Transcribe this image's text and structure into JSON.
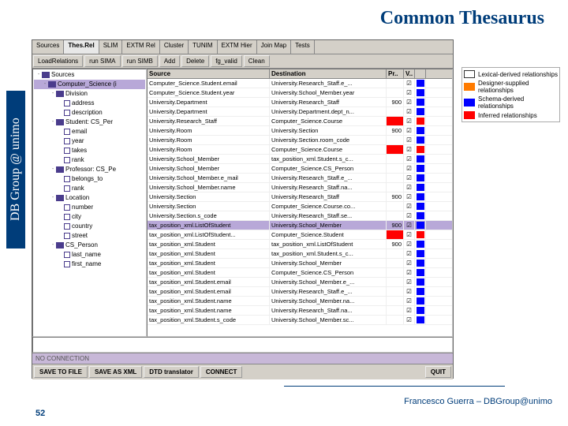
{
  "title": "Common Thesaurus",
  "sidebar_label": "DB Group @ unimo",
  "tabs": [
    "Sources",
    "Thes.Rel",
    "SLIM",
    "EXTM Rel",
    "Cluster",
    "TUNIM",
    "EXTM Hier",
    "Join Map",
    "Tests"
  ],
  "active_tab": 1,
  "toolbar": [
    "LoadRelations",
    "run SIMA",
    "run SIMB",
    "Add",
    "Delete",
    "fg_valid",
    "Clean"
  ],
  "tree": [
    {
      "l": "Sources",
      "d": 0,
      "t": "f",
      "h": "-"
    },
    {
      "l": "Computer_Science (i",
      "d": 1,
      "t": "f",
      "h": "-",
      "sel": true
    },
    {
      "l": "Division",
      "d": 2,
      "t": "f",
      "h": "-"
    },
    {
      "l": "address",
      "d": 3,
      "t": "n"
    },
    {
      "l": "description",
      "d": 3,
      "t": "n"
    },
    {
      "l": "Student: CS_Per",
      "d": 2,
      "t": "f",
      "h": "-"
    },
    {
      "l": "email",
      "d": 3,
      "t": "n"
    },
    {
      "l": "year",
      "d": 3,
      "t": "n"
    },
    {
      "l": "takes",
      "d": 3,
      "t": "n"
    },
    {
      "l": "rank",
      "d": 3,
      "t": "n"
    },
    {
      "l": "Professor: CS_Pe",
      "d": 2,
      "t": "f",
      "h": "-"
    },
    {
      "l": "belongs_to",
      "d": 3,
      "t": "n"
    },
    {
      "l": "rank",
      "d": 3,
      "t": "n"
    },
    {
      "l": "Location",
      "d": 2,
      "t": "f",
      "h": "-"
    },
    {
      "l": "number",
      "d": 3,
      "t": "n"
    },
    {
      "l": "city",
      "d": 3,
      "t": "n"
    },
    {
      "l": "country",
      "d": 3,
      "t": "n"
    },
    {
      "l": "street",
      "d": 3,
      "t": "n"
    },
    {
      "l": "CS_Person",
      "d": 2,
      "t": "f",
      "h": "-"
    },
    {
      "l": "last_name",
      "d": 3,
      "t": "n"
    },
    {
      "l": "first_name",
      "d": 3,
      "t": "n"
    }
  ],
  "grid_headers": {
    "src": "Source",
    "dest": "Destination",
    "pr": "Pr..",
    "v": "V..",
    "c": ""
  },
  "rows": [
    {
      "s": "Computer_Science.Student.email",
      "d": "University.Research_Staff.e_...",
      "p": "",
      "v": true,
      "c": "#0000ff"
    },
    {
      "s": "Computer_Science.Student.year",
      "d": "University.School_Member.year",
      "p": "",
      "v": true,
      "c": "#0000ff"
    },
    {
      "s": "University.Department",
      "d": "University.Research_Staff",
      "p": "900",
      "v": true,
      "c": "#0000ff"
    },
    {
      "s": "University.Department",
      "d": "University.Department.dept_n...",
      "p": "",
      "v": true,
      "c": "#0000ff"
    },
    {
      "s": "University.Research_Staff",
      "d": "Computer_Science.Course",
      "p": "",
      "v": true,
      "c": "#ff0000",
      "h": true
    },
    {
      "s": "University.Room",
      "d": "University.Section",
      "p": "900",
      "v": true,
      "c": "#0000ff"
    },
    {
      "s": "University.Room",
      "d": "University.Section.room_code",
      "p": "",
      "v": true,
      "c": "#0000ff"
    },
    {
      "s": "University.Room",
      "d": "Computer_Science.Course",
      "p": "",
      "v": true,
      "c": "#ff0000",
      "h": true
    },
    {
      "s": "University.School_Member",
      "d": "tax_position_xml.Student.s_c...",
      "p": "",
      "v": true,
      "c": "#0000ff"
    },
    {
      "s": "University.School_Member",
      "d": "Computer_Science.CS_Person",
      "p": "",
      "v": true,
      "c": "#0000ff"
    },
    {
      "s": "University.School_Member.e_mail",
      "d": "University.Research_Staff.e_...",
      "p": "",
      "v": true,
      "c": "#0000ff"
    },
    {
      "s": "University.School_Member.name",
      "d": "University.Research_Staff.na...",
      "p": "",
      "v": true,
      "c": "#0000ff"
    },
    {
      "s": "University.Section",
      "d": "University.Research_Staff",
      "p": "900",
      "v": true,
      "c": "#0000ff"
    },
    {
      "s": "University.Section",
      "d": "Computer_Science.Course.co...",
      "p": "",
      "v": true,
      "c": "#0000ff"
    },
    {
      "s": "University.Section.s_code",
      "d": "University.Research_Staff.se...",
      "p": "",
      "v": true,
      "c": "#0000ff"
    },
    {
      "s": "tax_position_xml.ListOfStudent",
      "d": "University.School_Member",
      "p": "900",
      "v": true,
      "c": "#0000ff",
      "sel": true
    },
    {
      "s": "tax_position_xml.ListOfStudent...",
      "d": "Computer_Science.Student",
      "p": "",
      "v": true,
      "c": "#ff0000",
      "h": true
    },
    {
      "s": "tax_position_xml.Student",
      "d": "tax_position_xml.ListOfStudent",
      "p": "900",
      "v": true,
      "c": "#0000ff"
    },
    {
      "s": "tax_position_xml.Student",
      "d": "tax_position_xml.Student.s_c...",
      "p": "",
      "v": true,
      "c": "#0000ff"
    },
    {
      "s": "tax_position_xml.Student",
      "d": "University.School_Member",
      "p": "",
      "v": true,
      "c": "#0000ff"
    },
    {
      "s": "tax_position_xml.Student",
      "d": "Computer_Science.CS_Person",
      "p": "",
      "v": true,
      "c": "#0000ff"
    },
    {
      "s": "tax_position_xml.Student.email",
      "d": "University.School_Member.e_...",
      "p": "",
      "v": true,
      "c": "#0000ff"
    },
    {
      "s": "tax_position_xml.Student.email",
      "d": "University.Research_Staff.e_...",
      "p": "",
      "v": true,
      "c": "#0000ff"
    },
    {
      "s": "tax_position_xml.Student.name",
      "d": "University.School_Member.na...",
      "p": "",
      "v": true,
      "c": "#0000ff"
    },
    {
      "s": "tax_position_xml.Student.name",
      "d": "University.Research_Staff.na...",
      "p": "",
      "v": true,
      "c": "#0000ff"
    },
    {
      "s": "tax_position_xml.Student.s_code",
      "d": "University.School_Member.sc...",
      "p": "",
      "v": true,
      "c": "#0000ff"
    }
  ],
  "status": "NO CONNECTION",
  "bottom_buttons_left": [
    "SAVE TO FILE",
    "SAVE AS XML",
    "DTD translator",
    "CONNECT"
  ],
  "bottom_button_right": "QUIT",
  "legend": [
    {
      "c": "#ffffff",
      "border": "#333",
      "l": "Lexical-derived relationships"
    },
    {
      "c": "#ff7b00",
      "l": "Designer-supplied relationships"
    },
    {
      "c": "#0000ff",
      "l": "Schema-derived relationships"
    },
    {
      "c": "#ff0000",
      "l": "Inferred relationships"
    }
  ],
  "footer": "Francesco Guerra – DBGroup@unimo",
  "slide_num": "52"
}
